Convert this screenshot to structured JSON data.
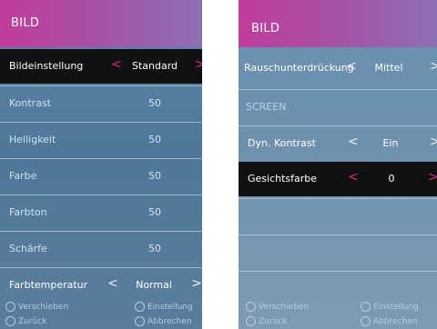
{
  "left": {
    "title": "BILD",
    "rows": [
      {
        "label": "Bildeinstellung",
        "value": "Standard",
        "left_arrow": "<",
        "right_arrow": ">"
      },
      {
        "label": "Kontrast",
        "value": "50"
      },
      {
        "label": "Helligkeit",
        "value": "50"
      },
      {
        "label": "Farbe",
        "value": "50"
      },
      {
        "label": "Farbton",
        "value": "50"
      },
      {
        "label": "Schärfe",
        "value": "50"
      },
      {
        "label": "Farbtemperatur",
        "value": "Normal",
        "left_arrow": "<",
        "right_arrow": ">"
      }
    ],
    "footer": {
      "move": "Verschieben",
      "back": "Zurück",
      "setting": "Einstellung",
      "cancel": "Abbrechen"
    }
  },
  "right": {
    "title": "BILD",
    "rows": [
      {
        "label": "Rauschunterdrückung",
        "value": "Mittel",
        "left_arrow": "<",
        "right_arrow": ">"
      },
      {
        "label": "SCREEN"
      },
      {
        "label": "Dyn. Kontrast",
        "value": "Ein",
        "left_arrow": "<",
        "right_arrow": ">"
      },
      {
        "label": "Gesichtsfarbe",
        "value": "0",
        "left_arrow": "<",
        "right_arrow": ">"
      }
    ],
    "footer": {
      "move": "Verschieben",
      "back": "Zurück",
      "setting": "Einstellung",
      "cancel": "Abbrechen"
    }
  },
  "colors": {
    "header_gradient_start": "#c13c9a",
    "header_gradient_end": "#8e70b6",
    "selected_bg": "#111111",
    "arrow_accent": "#d8288a",
    "panel_bg": "#5d89ac"
  }
}
